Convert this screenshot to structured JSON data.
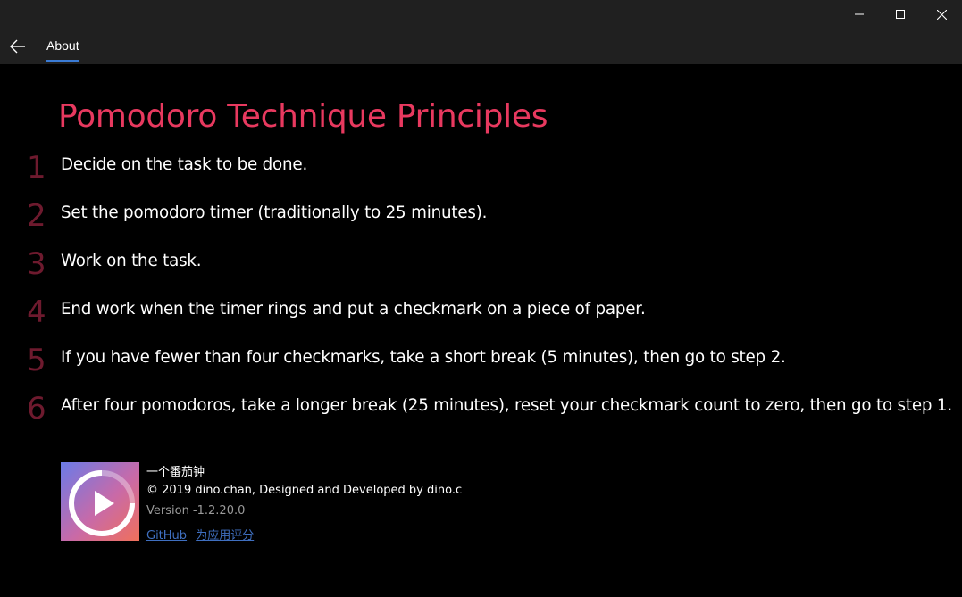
{
  "window": {
    "minimize_icon": "minimize-icon",
    "maximize_icon": "maximize-icon",
    "close_icon": "close-icon"
  },
  "nav": {
    "back_icon": "back-arrow-icon",
    "tab_label": "About",
    "accent": "#3a7bd5"
  },
  "title": "Pomodoro Technique Principles",
  "colors": {
    "title": "#e8395f",
    "step_number": "#6e1a2e",
    "link": "#3f6fc0"
  },
  "steps": [
    {
      "number": "1",
      "text": "Decide on the task to be done."
    },
    {
      "number": "2",
      "text": "Set the pomodoro timer (traditionally to 25 minutes)."
    },
    {
      "number": "3",
      "text": "Work on the task."
    },
    {
      "number": "4",
      "text": "End work when the timer rings and put a checkmark on a piece of paper."
    },
    {
      "number": "5",
      "text": "If you have fewer than four checkmarks, take a short break (5 minutes), then go to step 2."
    },
    {
      "number": "6",
      "text": "After four pomodoros, take a longer break (25 minutes), reset your checkmark count to zero, then go to step 1."
    }
  ],
  "app": {
    "icon": "play-icon",
    "name": "一个番茄钟",
    "copyright": "© 2019 dino.chan, Designed and Developed by dino.c",
    "version": "Version -1.2.20.0",
    "links": [
      "GitHub",
      "为应用评分"
    ]
  }
}
